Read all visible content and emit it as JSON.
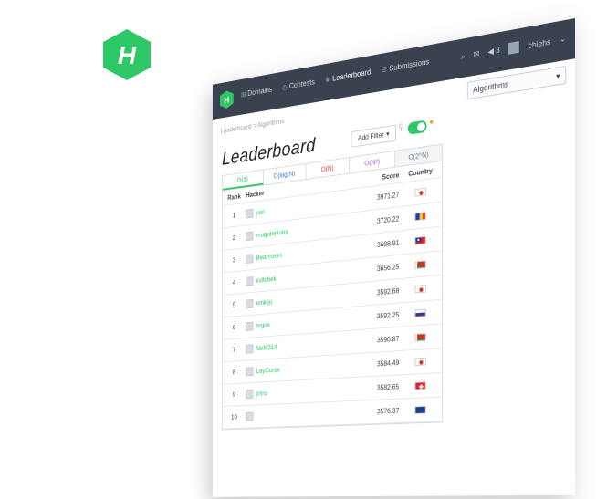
{
  "logo": {
    "letter": "H",
    "color": "#2ec866"
  },
  "nav": {
    "items": [
      {
        "label": "Domains",
        "icon": "grid-icon"
      },
      {
        "label": "Contests",
        "icon": "clock-icon"
      },
      {
        "label": "Leaderboard",
        "icon": "trophy-icon"
      },
      {
        "label": "Submissions",
        "icon": "list-icon"
      }
    ],
    "active": "Leaderboard",
    "notification_count": "3",
    "username": "chiehs"
  },
  "breadcrumb": "Leaderboard > Algorithms",
  "track_select": {
    "value": "Algorithms"
  },
  "page_title": "Leaderboard",
  "add_filter_label": "Add Filter",
  "tabs": [
    {
      "label": "O(1)"
    },
    {
      "label": "O(log(N)"
    },
    {
      "label": "O(N)"
    },
    {
      "label": "O(N²)"
    },
    {
      "label": "O(2^N)"
    }
  ],
  "table": {
    "headers": {
      "rank": "Rank",
      "hacker": "Hacker",
      "score": "Score",
      "country": "Country"
    },
    "rows": [
      {
        "rank": "1",
        "hacker": "uwi",
        "score": "3971.27",
        "flag": "japan"
      },
      {
        "rank": "2",
        "hacker": "muguneliuna",
        "score": "3720.22",
        "flag": "romania"
      },
      {
        "rank": "3",
        "hacker": "Bearmeon",
        "score": "3688.91",
        "flag": "taiwan"
      },
      {
        "rank": "4",
        "hacker": "svitchek",
        "score": "3656.25",
        "flag": "belarus"
      },
      {
        "rank": "5",
        "hacker": "emkijo",
        "score": "3592.68",
        "flag": "japan"
      },
      {
        "rank": "6",
        "hacker": "argos",
        "score": "3592.25",
        "flag": "russia"
      },
      {
        "rank": "7",
        "hacker": "NeM314",
        "score": "3590.87",
        "flag": "belarus"
      },
      {
        "rank": "8",
        "hacker": "LayCurse",
        "score": "3584.49",
        "flag": "japan"
      },
      {
        "rank": "9",
        "hacker": "tmru",
        "score": "3582.65",
        "flag": "switzerland"
      },
      {
        "rank": "10",
        "hacker": "",
        "score": "3576.37",
        "flag": "blue"
      }
    ]
  },
  "colors": {
    "topbar": "#39424e",
    "accent": "#2ec866"
  }
}
